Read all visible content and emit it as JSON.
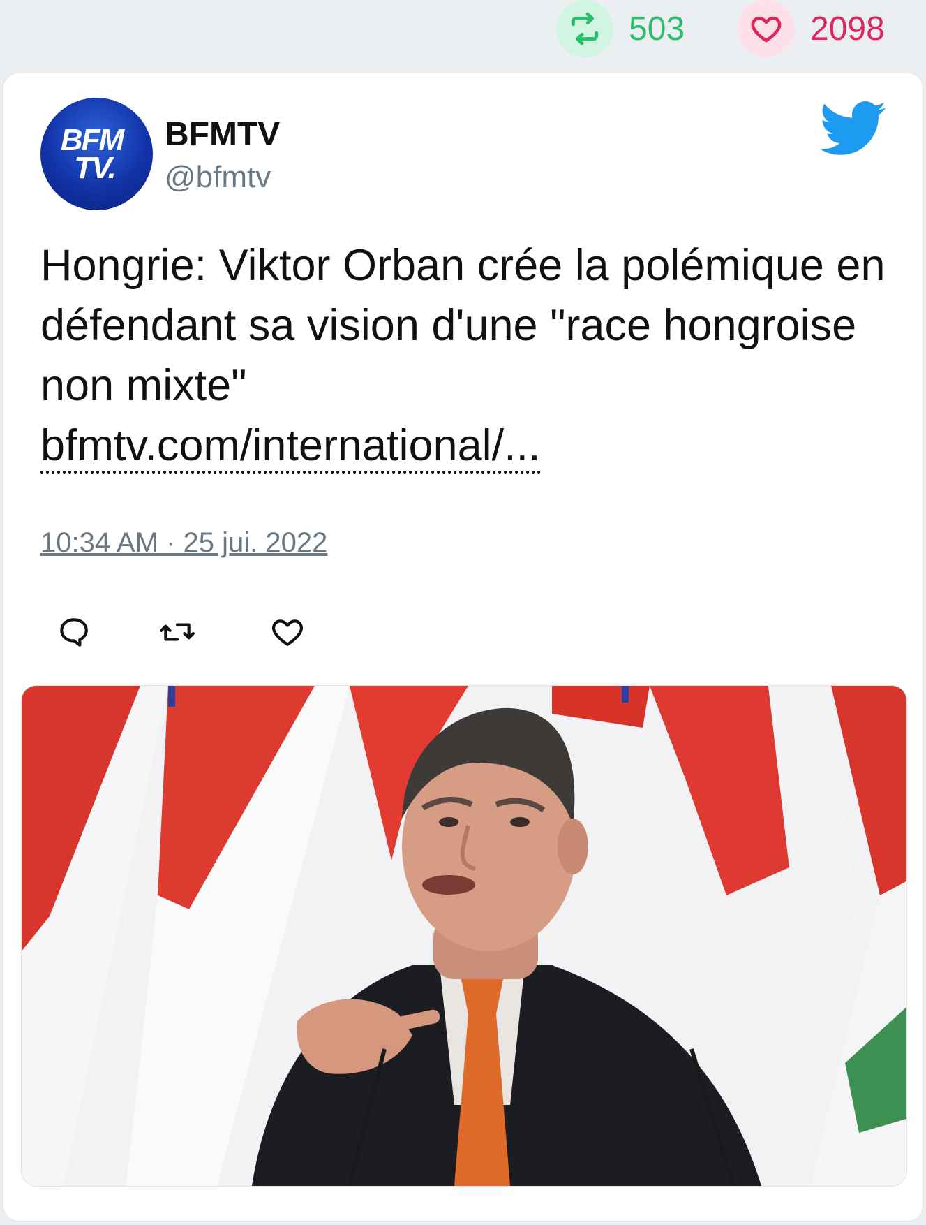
{
  "stats": {
    "retweets": "503",
    "likes": "2098",
    "retweet_color": "#2ebd6b",
    "like_color": "#e0245e"
  },
  "tweet": {
    "author_name": "BFMTV",
    "handle": "@bfmtv",
    "avatar_text_line1": "BFM",
    "avatar_text_line2": "TV.",
    "text": "Hongrie: Viktor Orban crée la polémique en défendant sa vision d'une \"race hongroise non mixte\"",
    "link": "bfmtv.com/international/...",
    "timestamp": "10:34 AM · 25 jui. 2022",
    "platform_icon": "twitter-bird-icon"
  },
  "actions": {
    "icons": [
      "reply-icon",
      "retweet-icon",
      "like-icon"
    ]
  },
  "media": {
    "image": "photo of a man in a dark suit and orange tie speaking in front of red-white-green flags"
  }
}
